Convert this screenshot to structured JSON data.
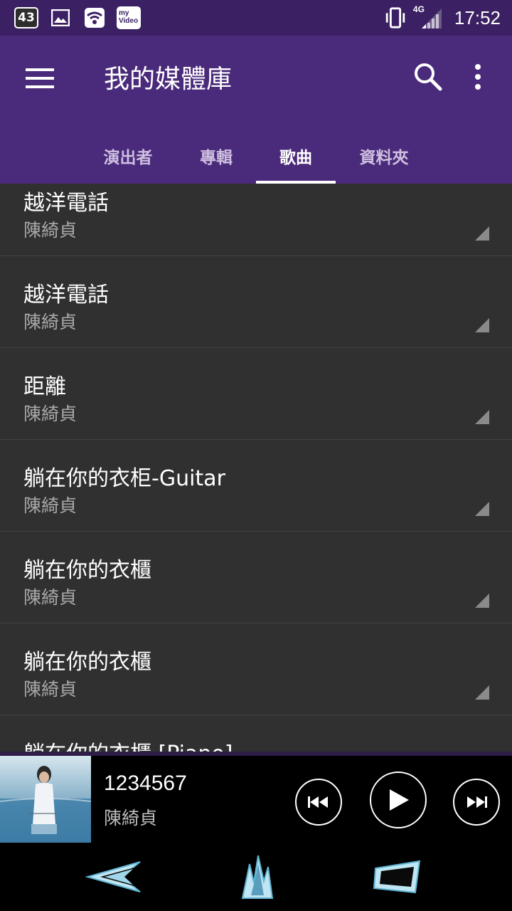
{
  "status_bar": {
    "notification_count": "43",
    "myvideo_label_line1": "my",
    "myvideo_label_line2": "Video",
    "network_type": "4G",
    "time": "17:52",
    "icons": [
      "gallery-icon",
      "wifi-hotspot-icon",
      "myvideo-icon",
      "vibrate-icon",
      "signal-icon"
    ]
  },
  "app_bar": {
    "title": "我的媒體庫",
    "background_color": "#4a2a7a",
    "status_color": "#3b2163"
  },
  "tabs": [
    {
      "label": "演出者",
      "active": false
    },
    {
      "label": "專輯",
      "active": false
    },
    {
      "label": "歌曲",
      "active": true
    },
    {
      "label": "資料夾",
      "active": false
    }
  ],
  "songs": [
    {
      "title": "越洋電話",
      "artist": "陳綺貞"
    },
    {
      "title": "越洋電話",
      "artist": "陳綺貞"
    },
    {
      "title": "距離",
      "artist": "陳綺貞"
    },
    {
      "title": "躺在你的衣柜-Guitar",
      "artist": "陳綺貞"
    },
    {
      "title": "躺在你的衣櫃",
      "artist": "陳綺貞"
    },
    {
      "title": "躺在你的衣櫃",
      "artist": "陳綺貞"
    },
    {
      "title": "躺在你的衣櫃 [Piano]",
      "artist": ""
    }
  ],
  "now_playing": {
    "title": "1234567",
    "artist": "陳綺貞"
  }
}
